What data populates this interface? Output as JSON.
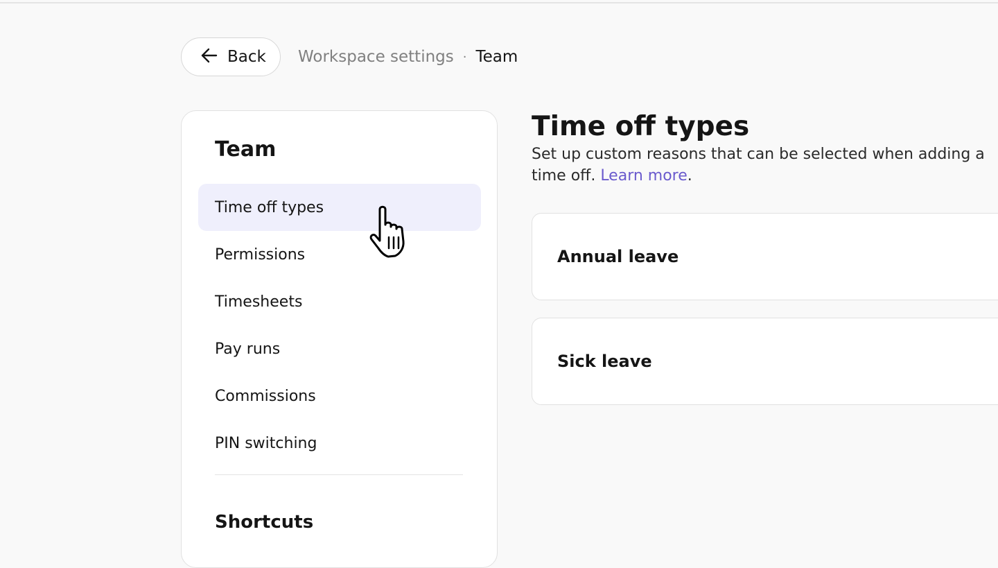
{
  "header": {
    "back_label": "Back",
    "back_icon": "arrow-left-icon",
    "breadcrumb": {
      "parent": "Workspace settings",
      "separator": "·",
      "current": "Team"
    }
  },
  "sidebar": {
    "heading": "Team",
    "items": [
      {
        "label": "Time off types",
        "active": true
      },
      {
        "label": "Permissions",
        "active": false
      },
      {
        "label": "Timesheets",
        "active": false
      },
      {
        "label": "Pay runs",
        "active": false
      },
      {
        "label": "Commissions",
        "active": false
      },
      {
        "label": "PIN switching",
        "active": false
      }
    ],
    "secondary_heading": "Shortcuts"
  },
  "main": {
    "title": "Time off types",
    "description": "Set up custom reasons that can be selected when adding a time off.",
    "description_prefix": "Set up custom reasons that can be selected when adding a time off. ",
    "learn_more_label": "Learn more",
    "learn_more_suffix": ".",
    "types": [
      {
        "name": "Annual leave"
      },
      {
        "name": "Sick leave"
      }
    ]
  },
  "colors": {
    "accent": "#6a5acd",
    "active_nav_bg": "#efeffc",
    "page_bg": "#f9f9f9"
  }
}
